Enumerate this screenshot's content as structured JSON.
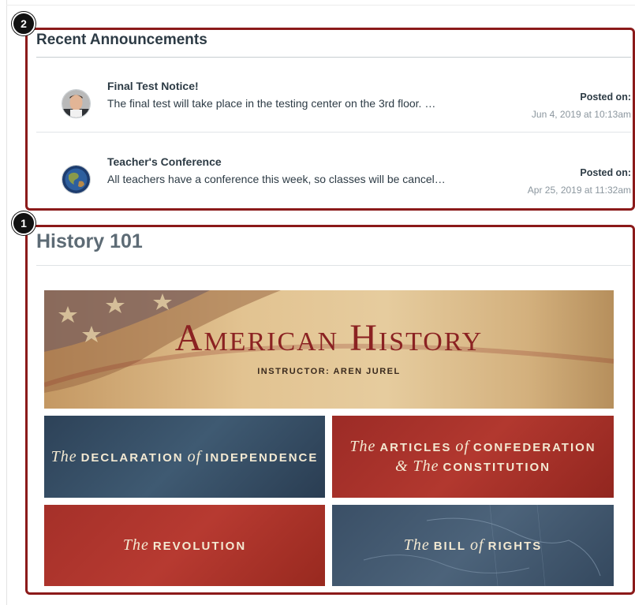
{
  "callouts": {
    "announcements_number": "2",
    "course_number": "1"
  },
  "announcements": {
    "title": "Recent Announcements",
    "items": [
      {
        "title": "Final Test Notice!",
        "message": "The final test will take place in the testing center on the 3rd floor. …",
        "posted_label": "Posted on:",
        "posted_date": "Jun 4, 2019 at 10:13am",
        "avatar_icon": "person-avatar-icon"
      },
      {
        "title": "Teacher's Conference",
        "message": "All teachers have a conference this week, so classes will be cancel…",
        "posted_label": "Posted on:",
        "posted_date": "Apr 25, 2019 at 11:32am",
        "avatar_icon": "globe-avatar-icon"
      }
    ]
  },
  "course": {
    "title": "History 101",
    "banner": {
      "title": "American History",
      "instructor": "INSTRUCTOR: AREN JUREL"
    },
    "tiles": [
      {
        "line1_it": "The",
        "line1": "DECLARATION",
        "line1_it2": "of",
        "line1b": "INDEPENDENCE",
        "line2_it": "",
        "line2": ""
      },
      {
        "line1_it": "The",
        "line1": "ARTICLES",
        "line1_it2": "of",
        "line1b": "CONFEDERATION",
        "line2_it": "& The",
        "line2": "CONSTITUTION"
      },
      {
        "line1_it": "The",
        "line1": "REVOLUTION",
        "line1_it2": "",
        "line1b": "",
        "line2_it": "",
        "line2": ""
      },
      {
        "line1_it": "The",
        "line1": "BILL",
        "line1_it2": "of",
        "line1b": "RIGHTS",
        "line2_it": "",
        "line2": ""
      }
    ]
  },
  "colors": {
    "callout_border": "#8b1a1a",
    "text_primary": "#2d3b45",
    "text_muted": "#8b969e",
    "tile_red": "#a8322c",
    "tile_blue": "#3a4f66"
  }
}
